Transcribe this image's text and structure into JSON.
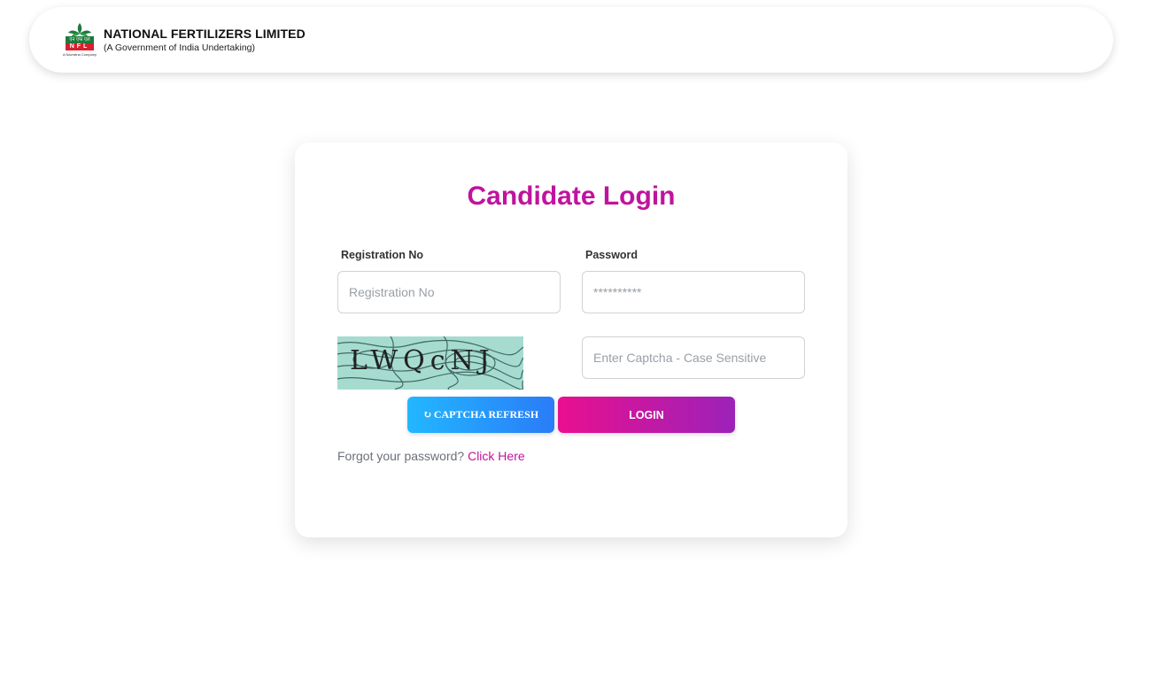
{
  "header": {
    "logo_text": "NFL",
    "logo_hindi": "एन एफ एल",
    "logo_tagline": "A Navratna Company",
    "org_name": "NATIONAL FERTILIZERS LIMITED",
    "org_subtitle": "(A Government of India Undertaking)"
  },
  "login": {
    "title": "Candidate Login",
    "registration_label": "Registration No",
    "registration_placeholder": "Registration No",
    "registration_value": "",
    "password_label": "Password",
    "password_placeholder": "**********",
    "password_value": "",
    "captcha_image_text": "LWQcNJ",
    "captcha_placeholder": "Enter Captcha - Case Sensitive",
    "captcha_value": "",
    "refresh_icon": "refresh-icon",
    "refresh_label": "CAPTCHA REFRESH",
    "login_label": "LOGIN",
    "forgot_text": "Forgot your password?",
    "forgot_link": "Click Here"
  },
  "colors": {
    "accent": "#c0139e",
    "refresh_start": "#22b7ff",
    "refresh_end": "#2a7cf7",
    "login_start": "#e90f8f",
    "login_end": "#9c22b9",
    "captcha_bg": "#a6dcd0",
    "logo_green": "#1e7a3c",
    "logo_red": "#d6202f"
  }
}
